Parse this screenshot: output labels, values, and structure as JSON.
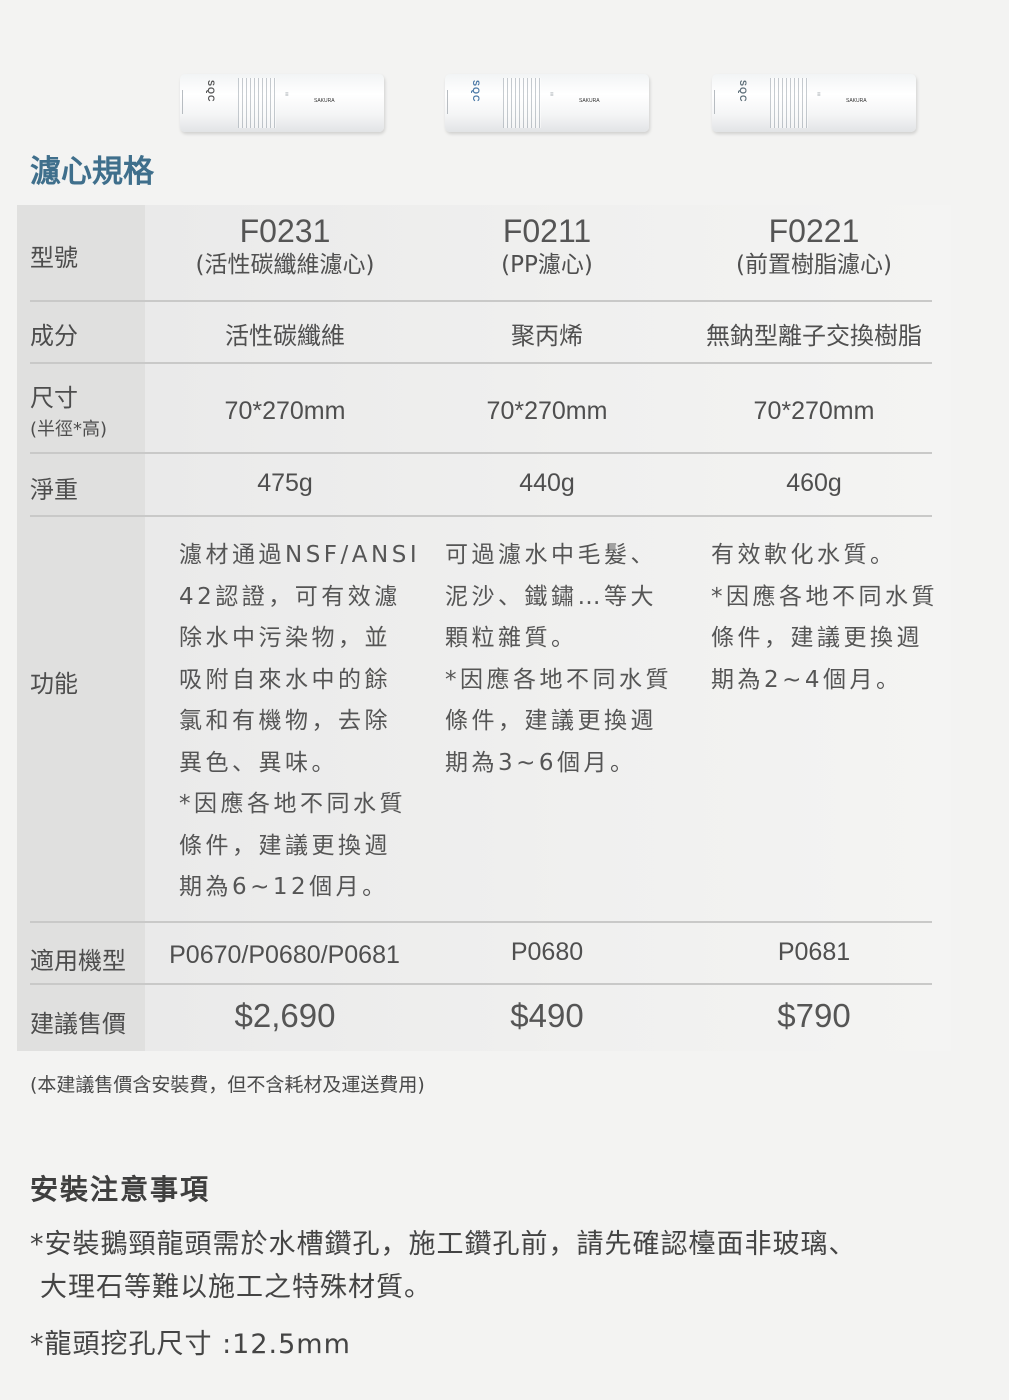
{
  "products": [
    {
      "logo": "SQC",
      "logo_color": "#555555",
      "brand": "SAKURA"
    },
    {
      "logo": "SQC",
      "logo_color": "#4a78a6",
      "brand": "SAKURA"
    },
    {
      "logo": "SQC",
      "logo_color": "#5d6e78",
      "brand": "SAKURA"
    }
  ],
  "section_title": "濾心規格",
  "colors": {
    "title": "#3f6f8c",
    "label_bg": "#e0e0df",
    "body_bg": "#f3f3f2"
  },
  "table": {
    "labels": {
      "model": "型號",
      "material": "成分",
      "size": "尺寸",
      "size_sub": "(半徑*高)",
      "weight": "淨重",
      "function": "功能",
      "compatible": "適用機型",
      "price": "建議售價"
    },
    "columns": [
      {
        "model": "F0231",
        "model_name": "(活性碳纖維濾心)",
        "material": "活性碳纖維",
        "size": "70*270mm",
        "weight": "475g",
        "function_lines": [
          "濾材通過NSF/ANSI",
          "42認證，可有效濾",
          "除水中污染物，並",
          "吸附自來水中的餘",
          "氯和有機物，去除",
          "異色、異味。",
          "*因應各地不同水質",
          "條件，建議更換週",
          "期為6~12個月。"
        ],
        "compatible": "P0670/P0680/P0681",
        "price": "$2,690"
      },
      {
        "model": "F0211",
        "model_name": "(PP濾心)",
        "material": "聚丙烯",
        "size": "70*270mm",
        "weight": "440g",
        "function_lines": [
          "可過濾水中毛髮、",
          "泥沙、鐵鏽…等大",
          "顆粒雜質。",
          "*因應各地不同水質",
          "條件，建議更換週",
          "期為3~6個月。"
        ],
        "compatible": "P0680",
        "price": "$490"
      },
      {
        "model": "F0221",
        "model_name": "(前置樹脂濾心)",
        "material": "無鈉型離子交換樹脂",
        "size": "70*270mm",
        "weight": "460g",
        "function_lines": [
          "有效軟化水質。",
          "*因應各地不同水質",
          "條件，建議更換週",
          "期為2~4個月。"
        ],
        "compatible": "P0681",
        "price": "$790"
      }
    ]
  },
  "price_note": "(本建議售價含安裝費，但不含耗材及運送費用)",
  "install": {
    "title": "安裝注意事項",
    "line1": "*安裝鵝頸龍頭需於水槽鑽孔，施工鑽孔前，請先確認檯面非玻璃、",
    "line2": "大理石等難以施工之特殊材質。",
    "line3": "*龍頭挖孔尺寸 :12.5mm"
  }
}
